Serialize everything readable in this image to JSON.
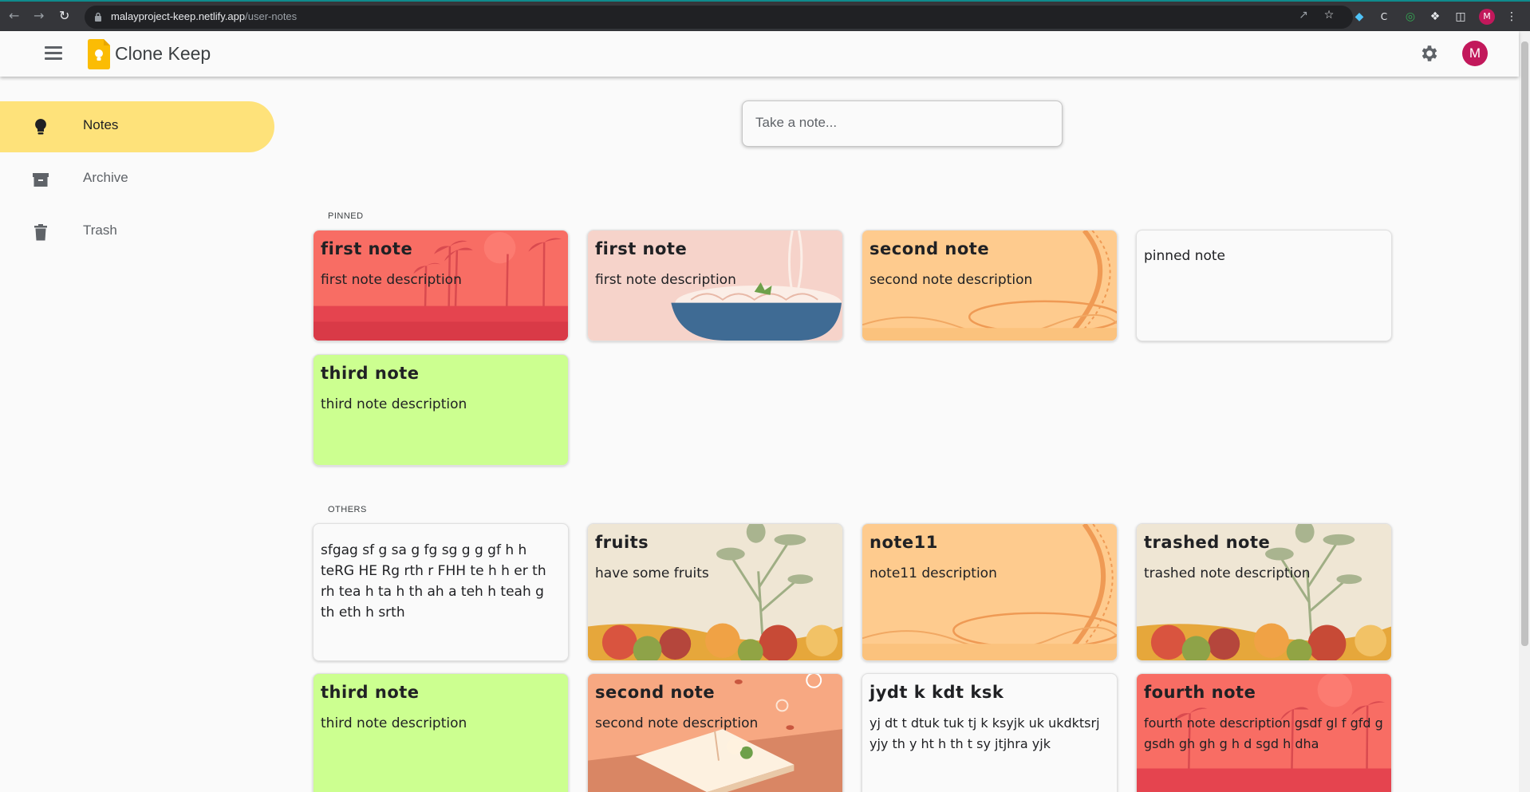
{
  "browser": {
    "url_host": "malayproject-keep.netlify.app",
    "url_path": "/user-notes",
    "profile_initial": "M"
  },
  "header": {
    "app_title": "Clone Keep",
    "avatar_initial": "M"
  },
  "sidebar": {
    "items": [
      {
        "label": "Notes",
        "icon": "lightbulb-icon",
        "active": true
      },
      {
        "label": "Archive",
        "icon": "archive-icon",
        "active": false
      },
      {
        "label": "Trash",
        "icon": "trash-icon",
        "active": false
      }
    ]
  },
  "composer": {
    "placeholder": "Take a note..."
  },
  "sections": {
    "pinned_label": "PINNED",
    "others_label": "OTHERS"
  },
  "pinned_notes": [
    {
      "title": "first note",
      "description": "first note description",
      "background": "palms-sunset"
    },
    {
      "title": "first note",
      "description": "first note description",
      "background": "noodle-bowl"
    },
    {
      "title": "second note",
      "description": "second note description",
      "background": "rollercoaster"
    },
    {
      "title": "",
      "description": "pinned note",
      "background": "plain-white"
    },
    {
      "title": "third note",
      "description": "third note description",
      "background": "plain-lime"
    }
  ],
  "other_notes": [
    {
      "title": "",
      "description": "sfgag sf g sa g fg sg g g gf h h teRG HE Rg rth r FHH te h h er th rh tea h ta h th ah a teh h teah g th eth h srth",
      "background": "plain-white"
    },
    {
      "title": "fruits",
      "description": "have some fruits",
      "background": "fruits"
    },
    {
      "title": "note11",
      "description": "note11 description",
      "background": "rollercoaster"
    },
    {
      "title": "trashed note",
      "description": "trashed note description",
      "background": "fruits"
    },
    {
      "title": "third note",
      "description": "third note description",
      "background": "plain-lime"
    },
    {
      "title": "second note",
      "description": "second note description",
      "background": "book"
    },
    {
      "title": "jydt k kdt ksk",
      "description": "yj dt t dtuk tuk tj k ksyjk uk ukdktsrj yjy th y ht h th t sy jtjhra yjk",
      "background": "plain-white"
    },
    {
      "title": "fourth note",
      "description": "fourth note description gsdf gl f gfd g gsdh gh gh g h d sgd h dha",
      "background": "palms-sunset"
    }
  ],
  "colors": {
    "active_nav": "#fee27a",
    "lime_card": "#ccff90",
    "profile_pink": "#c2185b"
  }
}
